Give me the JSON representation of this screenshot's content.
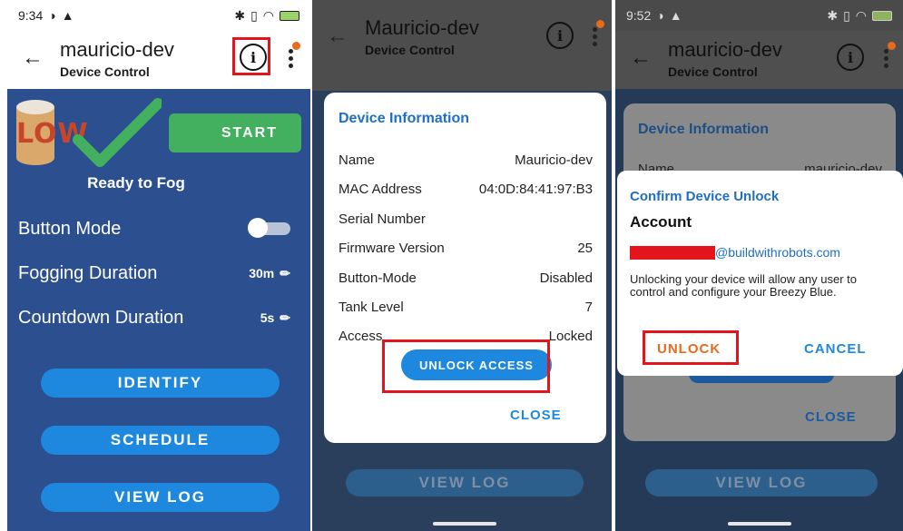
{
  "panel1": {
    "status": {
      "time": "9:34"
    },
    "appbar": {
      "title": "mauricio-dev",
      "subtitle": "Device Control"
    },
    "tank_label": "LOW",
    "start_label": "START",
    "ready_text": "Ready to Fog",
    "settings": [
      {
        "label": "Button Mode",
        "value": ""
      },
      {
        "label": "Fogging Duration",
        "value": "30m"
      },
      {
        "label": "Countdown Duration",
        "value": "5s"
      }
    ],
    "buttons": {
      "identify": "IDENTIFY",
      "schedule": "SCHEDULE",
      "view_log": "VIEW LOG"
    },
    "button_mode_on": false
  },
  "panel2": {
    "appbar": {
      "title": "Mauricio-dev",
      "subtitle": "Device Control"
    },
    "dialog": {
      "title": "Device Information",
      "rows": [
        {
          "label": "Name",
          "value": "Mauricio-dev"
        },
        {
          "label": "MAC Address",
          "value": "04:0D:84:41:97:B3"
        },
        {
          "label": "Serial Number",
          "value": ""
        },
        {
          "label": "Firmware Version",
          "value": "25"
        },
        {
          "label": "Button-Mode",
          "value": "Disabled"
        },
        {
          "label": "Tank Level",
          "value": "7"
        },
        {
          "label": "Access",
          "value": "Locked"
        }
      ],
      "unlock_label": "UNLOCK ACCESS",
      "close_label": "CLOSE"
    },
    "view_log": "VIEW LOG"
  },
  "panel3": {
    "status": {
      "time": "9:52"
    },
    "appbar": {
      "title": "mauricio-dev",
      "subtitle": "Device Control"
    },
    "back_dialog": {
      "title": "Device Information",
      "name_label": "Name",
      "name_value": "mauricio-dev",
      "close_label": "CLOSE"
    },
    "confirm": {
      "title": "Confirm Device Unlock",
      "account_label": "Account",
      "email_suffix": "@buildwithrobots.com",
      "message": "Unlocking your device will allow any user to control and configure your Breezy Blue.",
      "unlock_label": "UNLOCK",
      "cancel_label": "CANCEL"
    },
    "view_log": "VIEW LOG"
  },
  "colors": {
    "brand_blue": "#1e88de",
    "panel_blue": "#2b4f8f",
    "start_green": "#43b060",
    "highlight_red": "#e3141b",
    "title_blue": "#1e6fc6"
  }
}
